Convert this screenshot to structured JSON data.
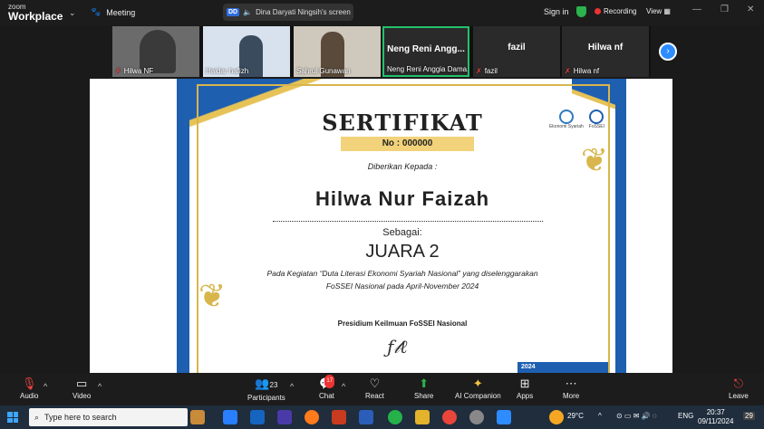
{
  "app": {
    "brand_small": "zoom",
    "brand": "Workplace",
    "meeting_label": "Meeting"
  },
  "share": {
    "badge": "DD",
    "label": "Dina Daryati Ningsih's screen"
  },
  "header": {
    "sign_in": "Sign in",
    "recording": "Recording",
    "view": "View"
  },
  "participants": [
    {
      "name": "Hilwa NF",
      "muted": true
    },
    {
      "name": "Haidar hafizh",
      "muted": false
    },
    {
      "name": "Sahrul Gunawan",
      "muted": false
    },
    {
      "name": "Neng Reni Anggia Dama...",
      "display": "Neng Reni Angg...",
      "muted": false
    },
    {
      "name": "fazil",
      "display": "fazil",
      "muted": true
    },
    {
      "name": "Hilwa nf",
      "display": "Hilwa nf",
      "muted": true
    }
  ],
  "certificate": {
    "title": "SERTIFIKAT",
    "number": "No : 000000",
    "given_to": "Diberikan Kepada :",
    "recipient": "Hilwa Nur Faizah",
    "as_label": "Sebagai:",
    "rank": "JUARA 2",
    "description_1": "Pada Kegiatan “Duta Literasi Ekonomi Syariah Nasional” yang diselenggarakan",
    "description_2": "FoSSEI Nasional pada April-November 2024",
    "presidium": "Presidium Keilmuan FoSSEI Nasional",
    "logo_1": "Ekonomi Syariah",
    "logo_2": "FoSSEI",
    "footer_badge": "2024"
  },
  "toolbar": {
    "audio": "Audio",
    "video": "Video",
    "participants": "Participants",
    "participants_count": "23",
    "chat": "Chat",
    "chat_badge": "17",
    "react": "React",
    "share": "Share",
    "ai": "AI Companion",
    "apps": "Apps",
    "more": "More",
    "leave": "Leave"
  },
  "taskbar": {
    "search_placeholder": "Type here to search",
    "temperature": "29°C",
    "lang": "ENG",
    "time": "20:37",
    "date": "09/11/2024",
    "notifications": "29"
  }
}
